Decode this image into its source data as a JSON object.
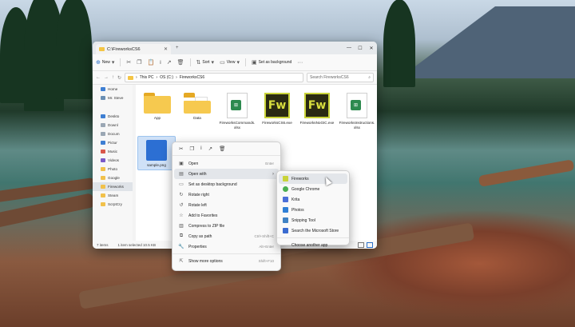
{
  "window": {
    "tab_title": "C:\\FireworksCS6",
    "minimize": "—",
    "maximize": "☐",
    "close": "✕"
  },
  "commandbar": {
    "new_label": "New",
    "sort_label": "Sort",
    "view_label": "View",
    "set_background_label": "Set as background",
    "more_label": "···"
  },
  "address": {
    "crumbs": [
      "This PC",
      "OS (C:)",
      "FireworksCS6"
    ],
    "search_placeholder": "Search FireworksCS6"
  },
  "sidebar": {
    "items": [
      {
        "label": "Home",
        "icon": "home-icon"
      },
      {
        "label": "Mr. Steve",
        "icon": "cloud-icon"
      },
      {
        "label": "Deskto",
        "icon": "desktop-icon"
      },
      {
        "label": "Downl",
        "icon": "download-icon"
      },
      {
        "label": "Docum",
        "icon": "document-icon"
      },
      {
        "label": "Pictur",
        "icon": "picture-icon"
      },
      {
        "label": "Music",
        "icon": "music-icon"
      },
      {
        "label": "Videos",
        "icon": "video-icon"
      },
      {
        "label": "Photo",
        "icon": "photo-icon"
      },
      {
        "label": "Google",
        "icon": "folder-icon"
      },
      {
        "label": "Fireworks",
        "icon": "folder-icon"
      },
      {
        "label": "Steam",
        "icon": "folder-icon"
      },
      {
        "label": "ScrptCry",
        "icon": "folder-icon"
      }
    ]
  },
  "files": [
    {
      "name": "App",
      "kind": "folder"
    },
    {
      "name": "Data",
      "kind": "folder-doc"
    },
    {
      "name": "FireworksCommands.xlsx",
      "kind": "doc"
    },
    {
      "name": "FireworksCS6.exe",
      "kind": "fw"
    },
    {
      "name": "FireworksNoGIC.exe",
      "kind": "fw"
    },
    {
      "name": "FireworksInstructions.xlsx",
      "kind": "doc"
    },
    {
      "name": "sample.png",
      "kind": "image"
    }
  ],
  "statusbar": {
    "items_count": "7 items",
    "selection": "1 item selected  10.5 KB"
  },
  "context_menu": {
    "items": [
      {
        "label": "Open",
        "shortcut": "Enter",
        "icon": "open-icon"
      },
      {
        "label": "Open with",
        "shortcut": "",
        "icon": "open-with-icon",
        "submenu": true
      },
      {
        "label": "Set as desktop background",
        "shortcut": "",
        "icon": "background-icon"
      },
      {
        "label": "Rotate right",
        "shortcut": "",
        "icon": "rotate-right-icon"
      },
      {
        "label": "Rotate left",
        "shortcut": "",
        "icon": "rotate-left-icon"
      },
      {
        "label": "Add to Favorites",
        "shortcut": "",
        "icon": "star-icon"
      },
      {
        "label": "Compress to ZIP file",
        "shortcut": "",
        "icon": "zip-icon"
      },
      {
        "label": "Copy as path",
        "shortcut": "Ctrl+Shift+C",
        "icon": "copy-path-icon"
      },
      {
        "label": "Properties",
        "shortcut": "Alt+Enter",
        "icon": "properties-icon"
      },
      {
        "label": "Show more options",
        "shortcut": "Shift+F10",
        "icon": "more-options-icon"
      }
    ]
  },
  "open_with": {
    "items": [
      {
        "label": "Fireworks",
        "color": "#c9d33a"
      },
      {
        "label": "Google Chrome",
        "color": "#4caf50"
      },
      {
        "label": "Krita",
        "color": "#4b6fd8"
      },
      {
        "label": "Photos",
        "color": "#2f7fd6"
      },
      {
        "label": "Snipping Tool",
        "color": "#3f82c4"
      },
      {
        "label": "Search the Microsoft Store",
        "color": "#3a6bd0"
      },
      {
        "label": "Choose another app",
        "color": ""
      }
    ]
  }
}
